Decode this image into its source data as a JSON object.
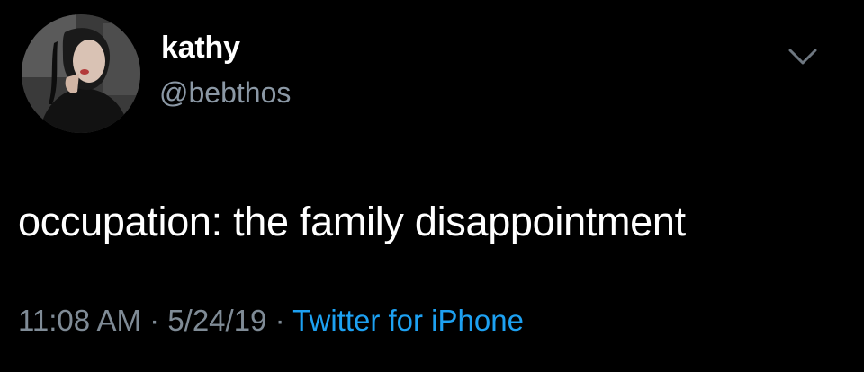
{
  "author": {
    "name": "kathy",
    "handle": "@bebthos",
    "avatar_icon": "profile-photo"
  },
  "menu": {
    "icon": "chevron-down-icon"
  },
  "tweet": {
    "text": "occupation: the family disappointment"
  },
  "meta": {
    "time": "11:08 AM",
    "sep1": " · ",
    "date": "5/24/19",
    "sep2": " · ",
    "source": "Twitter for iPhone"
  },
  "colors": {
    "background": "#000000",
    "text": "#ffffff",
    "muted": "#8b98a5",
    "link": "#1da1f2"
  }
}
